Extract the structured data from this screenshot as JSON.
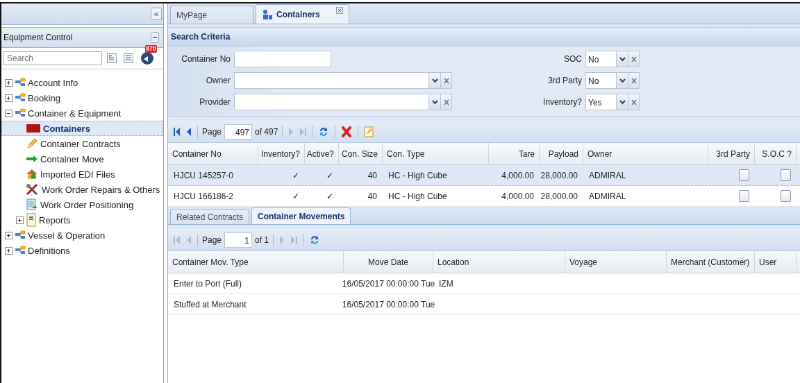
{
  "sidebar": {
    "collapse_button": "«",
    "title": "Equipment Control",
    "search": {
      "placeholder": "Search"
    },
    "badge": "870",
    "tree": [
      {
        "label": "Account Info",
        "kind": "folder",
        "expanded": false,
        "selected": false
      },
      {
        "label": "Booking",
        "kind": "folder",
        "expanded": false,
        "selected": false
      },
      {
        "label": "Container & Equipment",
        "kind": "folder",
        "expanded": true,
        "selected": false,
        "children": [
          {
            "label": "Containers",
            "kind": "container",
            "selected": true
          },
          {
            "label": "Container Contracts",
            "kind": "pencil",
            "selected": false
          },
          {
            "label": "Container Move",
            "kind": "arrow",
            "selected": false
          },
          {
            "label": "Imported EDI Files",
            "kind": "house",
            "selected": false
          },
          {
            "label": "Work Order Repairs & Others",
            "kind": "tools",
            "selected": false
          },
          {
            "label": "Work Order Positioning",
            "kind": "document",
            "selected": false
          },
          {
            "label": "Reports",
            "kind": "report",
            "expanded": false,
            "selected": false
          }
        ]
      },
      {
        "label": "Vessel & Operation",
        "kind": "folder",
        "expanded": false,
        "selected": false
      },
      {
        "label": "Definitions",
        "kind": "folder",
        "expanded": false,
        "selected": false
      }
    ]
  },
  "tabs": [
    {
      "label": "MyPage",
      "selected": false,
      "closable": false
    },
    {
      "label": "Containers",
      "selected": true,
      "closable": true
    }
  ],
  "search_criteria": {
    "title": "Search Criteria",
    "left_fields": [
      {
        "label": "Container No",
        "kind": "text"
      },
      {
        "label": "Owner",
        "kind": "combo"
      },
      {
        "label": "Provider",
        "kind": "combo"
      }
    ],
    "right_fields": [
      {
        "label": "SOC",
        "value": "No"
      },
      {
        "label": "3rd Party",
        "value": "No"
      },
      {
        "label": "Inventory?",
        "value": "Yes"
      }
    ]
  },
  "containers_toolbar": {
    "page_label": "Page",
    "page": "497",
    "page_count": "of 497",
    "buttons": [
      {
        "kind": "first",
        "disabled": false
      },
      {
        "kind": "prev",
        "disabled": false
      },
      {
        "kind": "sep"
      },
      {
        "kind": "page"
      },
      {
        "kind": "sep"
      },
      {
        "kind": "next",
        "disabled": true
      },
      {
        "kind": "last",
        "disabled": true
      },
      {
        "kind": "sep"
      },
      {
        "kind": "refresh",
        "disabled": false
      },
      {
        "kind": "sep"
      },
      {
        "kind": "delete",
        "disabled": false
      },
      {
        "kind": "sep"
      },
      {
        "kind": "edit",
        "disabled": false
      }
    ]
  },
  "containers_grid": {
    "columns": [
      {
        "label": "Container No"
      },
      {
        "label": "Inventory?"
      },
      {
        "label": "Active?"
      },
      {
        "label": "Con. Size"
      },
      {
        "label": "Con. Type"
      },
      {
        "label": "Tare"
      },
      {
        "label": "Payload"
      },
      {
        "label": "Owner"
      },
      {
        "label": "3rd Party"
      },
      {
        "label": "S.O.C ?"
      }
    ],
    "rows": [
      {
        "selected": true,
        "cells": [
          {
            "kind": "text",
            "text": "HJCU 145257-0"
          },
          {
            "kind": "text",
            "text": "✓"
          },
          {
            "kind": "text",
            "text": "✓"
          },
          {
            "kind": "text",
            "text": "40"
          },
          {
            "kind": "text",
            "text": "HC - High Cube"
          },
          {
            "kind": "text",
            "text": "4,000.00"
          },
          {
            "kind": "text",
            "text": "28,000.00"
          },
          {
            "kind": "text",
            "text": "ADMIRAL"
          },
          {
            "kind": "checkbox",
            "checked": false
          },
          {
            "kind": "checkbox",
            "checked": false
          }
        ]
      },
      {
        "selected": false,
        "cells": [
          {
            "kind": "text",
            "text": "HJCU 166186-2"
          },
          {
            "kind": "text",
            "text": "✓"
          },
          {
            "kind": "text",
            "text": "✓"
          },
          {
            "kind": "text",
            "text": "40"
          },
          {
            "kind": "text",
            "text": "HC - High Cube"
          },
          {
            "kind": "text",
            "text": "4,000.00"
          },
          {
            "kind": "text",
            "text": "28,000.00"
          },
          {
            "kind": "text",
            "text": "ADMIRAL"
          },
          {
            "kind": "checkbox",
            "checked": false
          },
          {
            "kind": "checkbox",
            "checked": false
          }
        ]
      }
    ]
  },
  "detail_tabs": [
    {
      "label": "Related Contracts",
      "selected": false
    },
    {
      "label": "Container Movements",
      "selected": true
    }
  ],
  "movements_toolbar": {
    "page_label": "Page",
    "page": "1",
    "page_count": "of 1",
    "buttons": [
      {
        "kind": "first",
        "disabled": true
      },
      {
        "kind": "prev",
        "disabled": true
      },
      {
        "kind": "sep"
      },
      {
        "kind": "page"
      },
      {
        "kind": "sep"
      },
      {
        "kind": "next",
        "disabled": true
      },
      {
        "kind": "last",
        "disabled": true
      },
      {
        "kind": "sep"
      },
      {
        "kind": "refresh",
        "disabled": false
      }
    ]
  },
  "movements_grid": {
    "columns": [
      {
        "label": "Container Mov. Type"
      },
      {
        "label": "Move Date"
      },
      {
        "label": "Location"
      },
      {
        "label": "Voyage"
      },
      {
        "label": "Merchant (Customer)"
      },
      {
        "label": "User"
      }
    ],
    "rows": [
      {
        "selected": false,
        "cells": [
          {
            "kind": "text",
            "text": "Enter to Port (Full)"
          },
          {
            "kind": "text",
            "text": "16/05/2017 00:00:00 Tue"
          },
          {
            "kind": "text",
            "text": "IZM"
          },
          {
            "kind": "empty"
          },
          {
            "kind": "empty"
          },
          {
            "kind": "empty"
          }
        ]
      },
      {
        "selected": false,
        "cells": [
          {
            "kind": "text",
            "text": "Stuffed at Merchant"
          },
          {
            "kind": "text",
            "text": "16/05/2017 00:00:00 Tue"
          },
          {
            "kind": "empty"
          },
          {
            "kind": "empty"
          },
          {
            "kind": "empty"
          },
          {
            "kind": "empty"
          }
        ]
      }
    ]
  }
}
